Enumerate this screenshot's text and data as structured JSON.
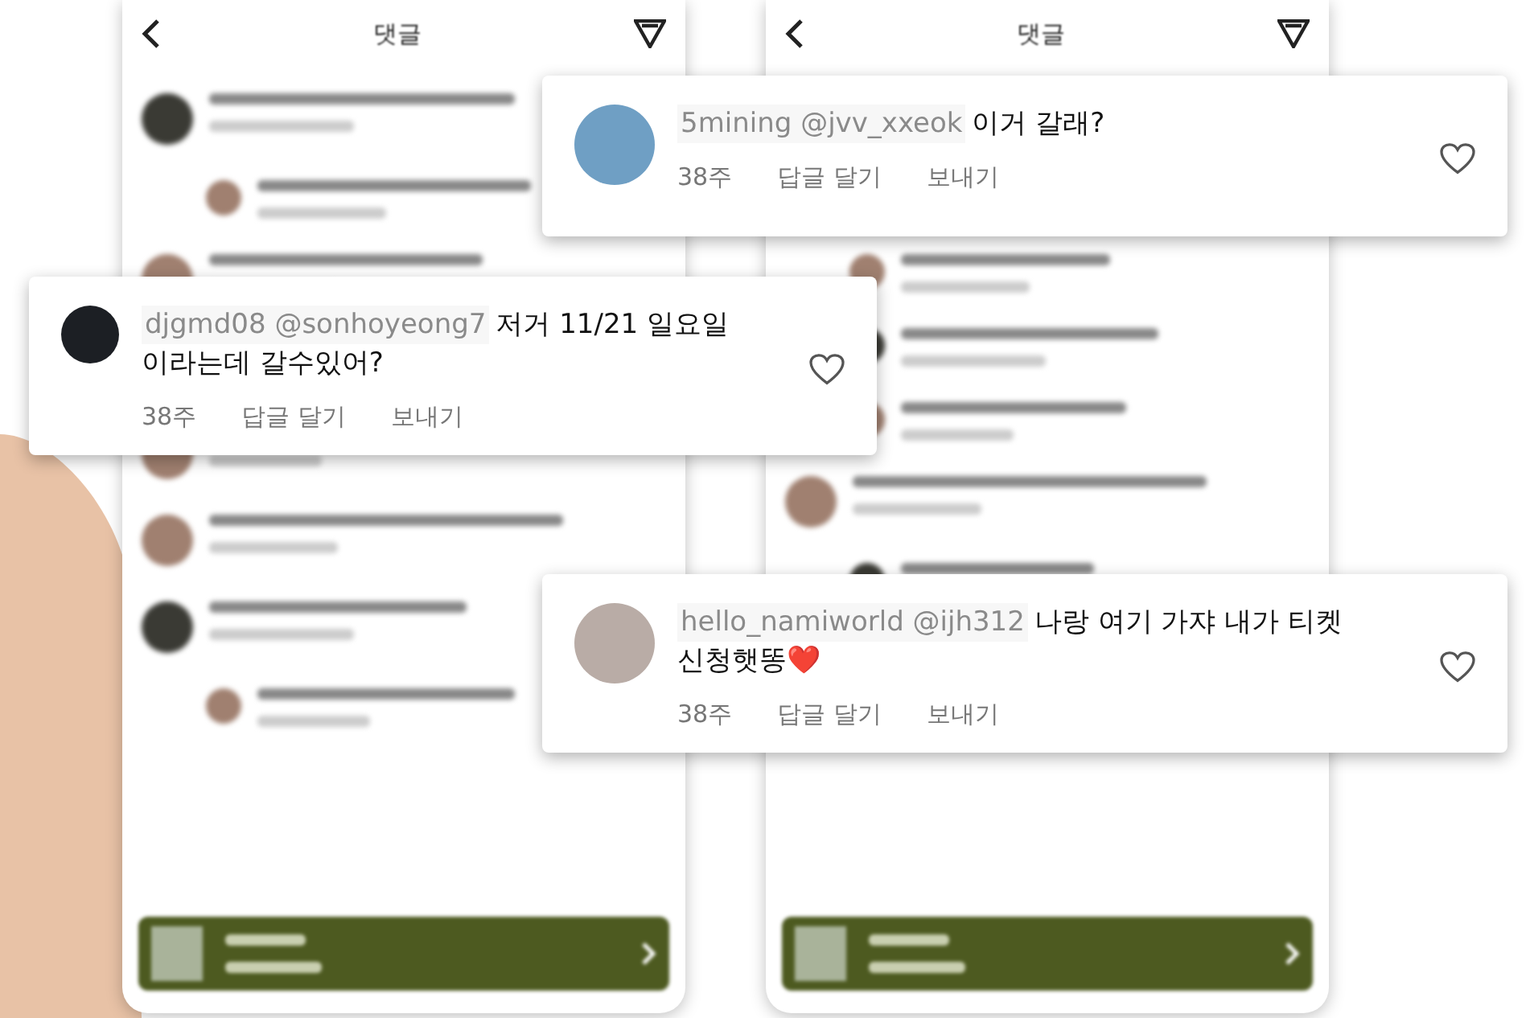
{
  "phones": [
    {
      "title": "댓글"
    },
    {
      "title": "댓글"
    }
  ],
  "callouts": [
    {
      "name": "5mining @jvv_xxeok",
      "text": "이거 갈래?",
      "time": "38주",
      "reply": "답글 달기",
      "send": "보내기",
      "liked": false
    },
    {
      "name": "djgmd08 @sonhoyeong7",
      "text": "저거 11/21 일요일 이라는데 갈수있어?",
      "time": "38주",
      "reply": "답글 달기",
      "send": "보내기",
      "liked": false
    },
    {
      "name": "hello_namiworld @ijh312",
      "text": "나랑 여기 가쟈 내가 티켓 신청햇똥❤️",
      "time": "38주",
      "reply": "답글 달기",
      "send": "보내기",
      "liked": false
    }
  ]
}
